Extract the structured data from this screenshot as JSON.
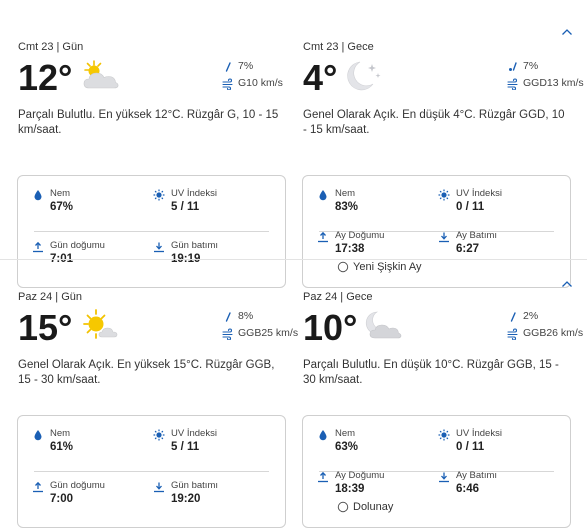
{
  "colors": {
    "accent": "#1a5fb4",
    "text": "#2b2b2b",
    "border": "#cfcfcf"
  },
  "days": [
    {
      "day": {
        "header": "Cmt 23 | Gün",
        "temp": "12°",
        "icon": "partly-cloudy-day-icon",
        "precip": "7%",
        "wind": "G10 km/s",
        "description": "Parçalı Bulutlu. En yüksek 12°C. Rüzgâr G, 10 - 15 km/saat.",
        "humidity_label": "Nem",
        "humidity": "67%",
        "uv_label": "UV İndeksi",
        "uv": "5 / 11",
        "rise_label": "Gün doğumu",
        "rise": "7:01",
        "set_label": "Gün batımı",
        "set": "19:19"
      },
      "night": {
        "header": "Cmt 23 | Gece",
        "temp": "4°",
        "icon": "clear-night-moon-icon",
        "precip": "7%",
        "wind": "GGD13 km/s",
        "description": "Genel Olarak Açık. En düşük 4°C. Rüzgâr GGD, 10 - 15 km/saat.",
        "humidity_label": "Nem",
        "humidity": "83%",
        "uv_label": "UV İndeksi",
        "uv": "0 / 11",
        "rise_label": "Ay Doğumu",
        "rise": "17:38",
        "set_label": "Ay Batımı",
        "set": "6:27",
        "moon_phase": "Yeni Şişkin Ay"
      }
    },
    {
      "day": {
        "header": "Paz 24 | Gün",
        "temp": "15°",
        "icon": "mostly-sunny-icon",
        "precip": "8%",
        "wind": "GGB25 km/s",
        "description": "Genel Olarak Açık. En yüksek 15°C. Rüzgâr GGB, 15 - 30 km/saat.",
        "humidity_label": "Nem",
        "humidity": "61%",
        "uv_label": "UV İndeksi",
        "uv": "5 / 11",
        "rise_label": "Gün doğumu",
        "rise": "7:00",
        "set_label": "Gün batımı",
        "set": "19:20"
      },
      "night": {
        "header": "Paz 24 | Gece",
        "temp": "10°",
        "icon": "partly-cloudy-night-icon",
        "precip": "2%",
        "wind": "GGB26 km/s",
        "description": "Parçalı Bulutlu. En düşük 10°C. Rüzgâr GGB, 15 - 30 km/saat.",
        "humidity_label": "Nem",
        "humidity": "63%",
        "uv_label": "UV İndeksi",
        "uv": "0 / 11",
        "rise_label": "Ay Doğumu",
        "rise": "18:39",
        "set_label": "Ay Batımı",
        "set": "6:46",
        "moon_phase": "Dolunay"
      }
    }
  ]
}
